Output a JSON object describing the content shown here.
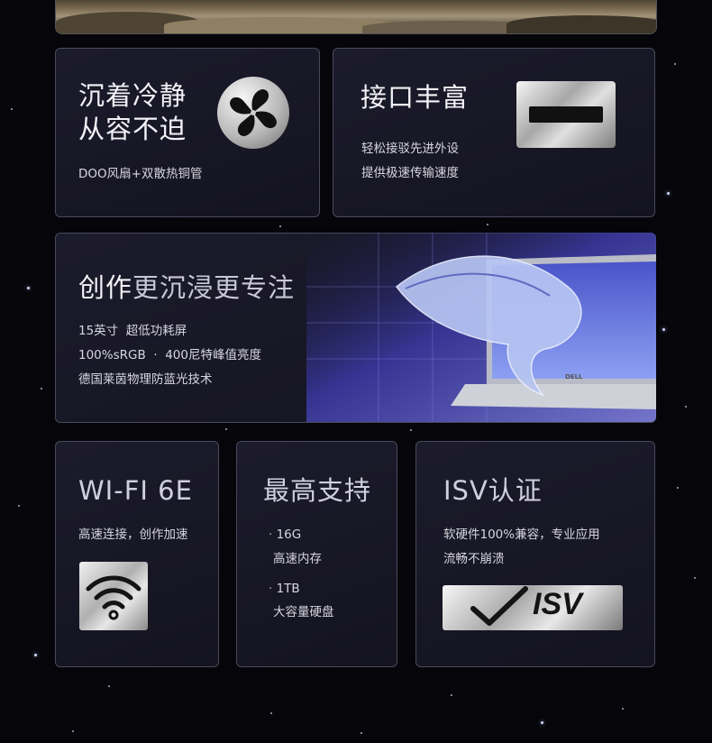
{
  "cards": {
    "cooling": {
      "title": "沉着冷静\n从容不迫",
      "desc": "DOO风扇+双散热铜管",
      "icon": "fan-icon"
    },
    "ports": {
      "title": "接口丰富",
      "desc_line1": "轻松接驳先进外设",
      "desc_line2": "提供极速传输速度",
      "icon": "port-icon"
    },
    "display": {
      "title_part1": "创作",
      "title_part2": "更沉浸更专注",
      "spec1": "15英寸  超低功耗屏",
      "spec2": "100%sRGB  ·  400尼特峰值亮度",
      "spec3": "德国莱茵物理防蓝光技术",
      "brand": "DELL"
    },
    "wifi": {
      "title": "WI-FI 6E",
      "desc": "高速连接，创作加速",
      "icon": "wifi-icon"
    },
    "memory": {
      "title": "最高支持",
      "mem_value": "16G",
      "mem_label": "高速内存",
      "disk_value": "1TB",
      "disk_label": "大容量硬盘"
    },
    "isv": {
      "title": "ISV认证",
      "desc_line1": "软硬件100%兼容，专业应用",
      "desc_line2": "流畅不崩溃",
      "badge_text": "ISV",
      "icon": "checkmark-icon"
    }
  },
  "colors": {
    "background": "#05050a",
    "card": "#1a1929",
    "card_border": "#4a4a5c",
    "accent_purple": "#5b5bd6"
  }
}
